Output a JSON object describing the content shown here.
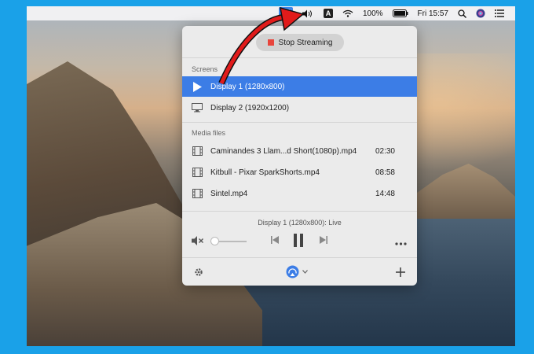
{
  "menubar": {
    "battery": "100%",
    "clock": "Fri 15:57",
    "input_source": "A",
    "icons": [
      "airplay-icon",
      "volume-icon",
      "input-source-icon",
      "wifi-icon",
      "battery-icon",
      "search-icon",
      "siri-icon",
      "notification-center-icon"
    ]
  },
  "panel": {
    "stop_label": "Stop Streaming",
    "screens_label": "Screens",
    "screens": [
      {
        "label": "Display 1 (1280x800)",
        "icon": "play-icon",
        "selected": true
      },
      {
        "label": "Display 2 (1920x1200)",
        "icon": "monitor-icon",
        "selected": false
      }
    ],
    "media_label": "Media files",
    "media": [
      {
        "label": "Caminandes 3  Llam...d Short(1080p).mp4",
        "duration": "02:30",
        "icon": "film-icon"
      },
      {
        "label": "Kitbull - Pixar SparkShorts.mp4",
        "duration": "08:58",
        "icon": "film-icon"
      },
      {
        "label": "Sintel.mp4",
        "duration": "14:48",
        "icon": "film-icon"
      }
    ],
    "status": "Display 1 (1280x800): Live",
    "volume_level": 0,
    "accent": "#3c7de6",
    "stop_color": "#e8453c"
  }
}
